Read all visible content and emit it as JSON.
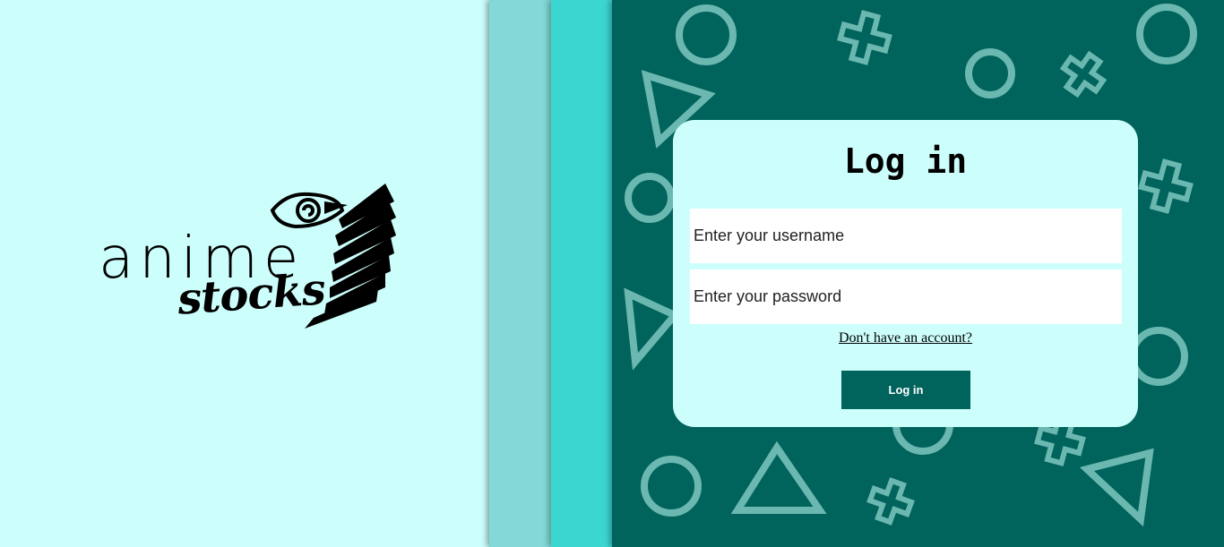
{
  "colors": {
    "bg_left": "#ccfffc",
    "stripe1": "#82d9d7",
    "stripe2": "#3cd6d1",
    "bg_dark": "#00635c",
    "shape": "#6bb8b1"
  },
  "logo": {
    "word_top": "anime",
    "word_bottom": "stocks",
    "emblem_icon": "wings-of-freedom-leaf-emblem"
  },
  "login": {
    "title": "Log in",
    "username_placeholder": "Enter your username",
    "username_value": "",
    "password_placeholder": "Enter your password",
    "password_value": "",
    "signup_link": "Don't have an account?",
    "submit_label": "Log in"
  }
}
